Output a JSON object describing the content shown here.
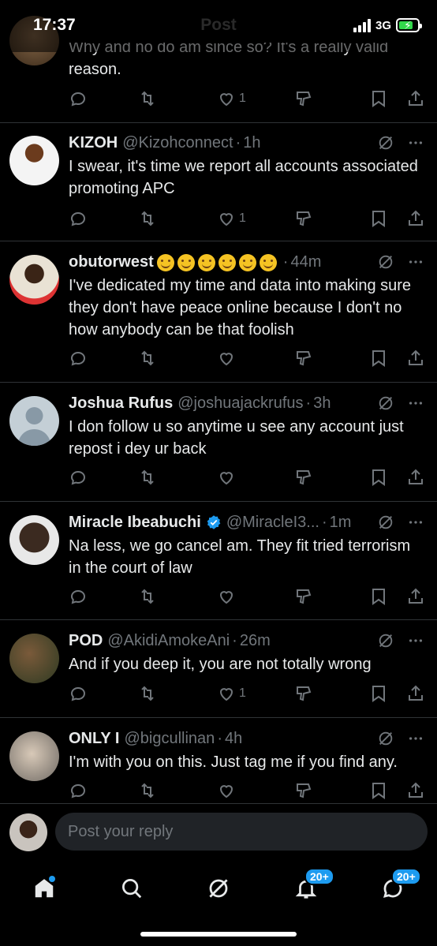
{
  "status": {
    "time": "17:37",
    "title": "Post",
    "network": "3G"
  },
  "top_partial": {
    "text": "Why and no do am since so? It's a really valid reason.",
    "likes": "1"
  },
  "tweets": [
    {
      "name": "KIZOH",
      "handle": "@Kizohconnect",
      "time": "1h",
      "text": "I swear, it's time we report all accounts associated promoting APC",
      "likes": "1"
    },
    {
      "name": "obutorwest",
      "handle": "",
      "time": "44m",
      "text": "I've dedicated my time and data into making sure they don't have peace online because I don't no how anybody can be that foolish",
      "likes": ""
    },
    {
      "name": "Joshua Rufus",
      "handle": "@joshuajackrufus",
      "time": "3h",
      "text": "I don follow u so anytime u see any account just repost i dey ur back",
      "likes": ""
    },
    {
      "name": "Miracle Ibeabuchi",
      "handle": "@MiracleI3...",
      "time": "1m",
      "text": "Na less, we go cancel am. They fit tried terrorism in the court of law",
      "likes": ""
    },
    {
      "name": "POD",
      "handle": "@AkidiAmokeAni",
      "time": "26m",
      "text": "And if you deep it, you are not totally wrong",
      "likes": "1"
    },
    {
      "name": "ONLY I",
      "handle": "@bigcullinan",
      "time": "4h",
      "text": "I'm with you on this. Just tag me if you find any.",
      "likes": ""
    }
  ],
  "reply": {
    "placeholder": "Post your reply"
  },
  "tabs": {
    "notifications_badge": "20+",
    "messages_badge": "20+"
  },
  "colors": {
    "accent": "#1d9bf0",
    "background": "#000000",
    "muted": "#71767b",
    "battery": "#32d74b"
  }
}
